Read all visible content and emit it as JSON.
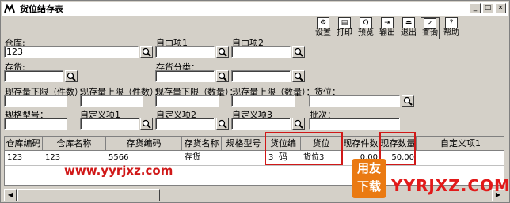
{
  "window": {
    "title": "货位结存表"
  },
  "toolbar": {
    "buttons": [
      {
        "label": "设置"
      },
      {
        "label": "打印"
      },
      {
        "label": "预览"
      },
      {
        "label": "输出"
      },
      {
        "label": "退出"
      },
      {
        "label": "查询"
      },
      {
        "label": "帮助"
      }
    ]
  },
  "filters": {
    "warehouse": {
      "label": "仓库:",
      "value": "123"
    },
    "custom1": {
      "label": "自由项1",
      "value": ""
    },
    "custom2": {
      "label": "自由项2",
      "value": ""
    },
    "inventory": {
      "label": "存货:",
      "value": ""
    },
    "inv_class": {
      "label": "存货分类：",
      "value": ""
    },
    "min_qty_pcs": {
      "label": "现存量下限（件数）：",
      "value": ""
    },
    "max_qty_pcs": {
      "label": "现存量上限（件数）：",
      "value": ""
    },
    "min_qty_num": {
      "label": "现存量下限（数量）：",
      "value": ""
    },
    "max_qty_num": {
      "label": "现存量上限（数量）：",
      "value": ""
    },
    "location": {
      "label": "货位：",
      "value": ""
    },
    "spec": {
      "label": "规格型号：",
      "value": ""
    },
    "def1": {
      "label": "自定义项1",
      "value": ""
    },
    "def2": {
      "label": "自定义项2",
      "value": ""
    },
    "def3": {
      "label": "自定义项3",
      "value": ""
    },
    "batch": {
      "label": "批次：",
      "value": ""
    }
  },
  "table": {
    "headers": [
      "仓库编码",
      "仓库名称",
      "存货编码",
      "存货名称",
      "规格型号",
      "货位编码",
      "货位",
      "现存件数",
      "现存数量",
      "自定义项1"
    ],
    "rows": [
      [
        "123",
        "123",
        "5566",
        "存货",
        "",
        "3",
        "货位3",
        "0.00",
        "50.00",
        ""
      ]
    ]
  },
  "watermark": {
    "url": "www.yyrjxz.com",
    "badge_top": "用友",
    "badge_bottom": "下载",
    "brand": "YYRJXZ.COM"
  }
}
